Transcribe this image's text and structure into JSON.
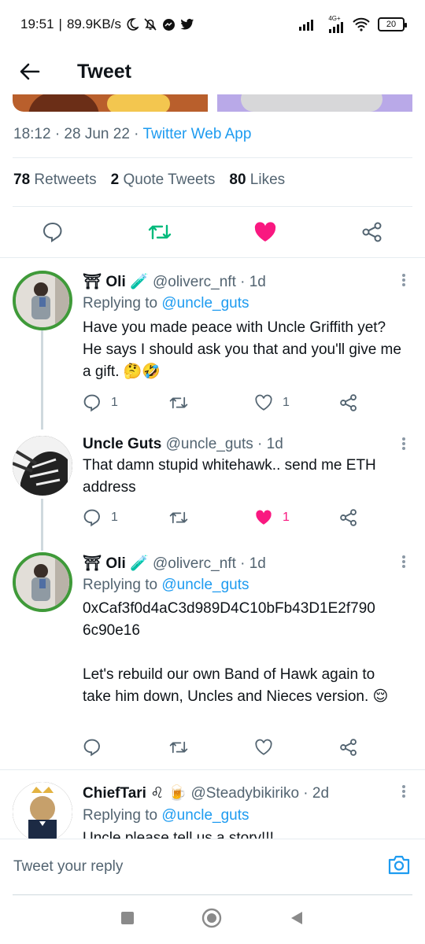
{
  "status_bar": {
    "time": "19:51",
    "speed": "89.9KB/s",
    "net_label": "4G+",
    "battery": "20"
  },
  "app_bar": {
    "title": "Tweet"
  },
  "tweet": {
    "meta_time": "18:12 · 28 Jun 22 ·",
    "meta_app": "Twitter Web App",
    "retweets_count": "78",
    "retweets_label": "Retweets",
    "quotes_count": "2",
    "quotes_label": "Quote Tweets",
    "likes_count": "80",
    "likes_label": "Likes"
  },
  "replies": [
    {
      "name": "⛩ Oli 🧪",
      "handle": "@oliverc_nft · 1d",
      "replying_prefix": "Replying to ",
      "replying_to": "@uncle_guts",
      "body": "Have you made peace with Uncle Griffith yet? He says I should ask you that and you'll give me a gift. 🤔🤣",
      "reply_count": "1",
      "retweet_count": "",
      "like_count": "1",
      "liked": false
    },
    {
      "name": "Uncle Guts",
      "handle": "@uncle_guts · 1d",
      "body": "That damn stupid whitehawk.. send me ETH address",
      "reply_count": "1",
      "retweet_count": "",
      "like_count": "1",
      "liked": true
    },
    {
      "name": "⛩ Oli 🧪",
      "handle": "@oliverc_nft · 1d",
      "replying_prefix": "Replying to ",
      "replying_to": "@uncle_guts",
      "body_line1": "0xCaf3f0d4aC3d989D4C10bFb43D1E2f790",
      "body_line2": "6c90e16",
      "body_para2": "Let's rebuild our own Band of Hawk again to take him down, Uncles and Nieces version. 😌",
      "reply_count": "",
      "retweet_count": "",
      "like_count": "",
      "liked": false
    },
    {
      "name": "ChiefTari ♌ 🍺",
      "handle": "@Steadybikiriko · 2d",
      "replying_prefix": "Replying to ",
      "replying_to": "@uncle_guts",
      "body": "Uncle please tell us a story!!!"
    }
  ],
  "composer": {
    "placeholder": "Tweet your reply"
  },
  "colors": {
    "accent": "#1d9bf0",
    "like": "#f91880",
    "retweet": "#00ba7c",
    "avatar_ring": "#3f9a39"
  }
}
